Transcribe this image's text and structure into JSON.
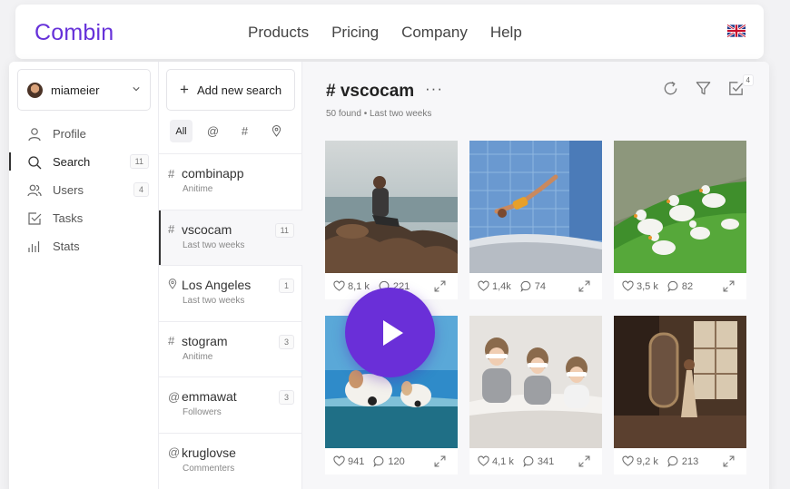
{
  "brand": {
    "logo": "Combin",
    "color": "#6631d9"
  },
  "nav": {
    "links": [
      "Products",
      "Pricing",
      "Company",
      "Help"
    ],
    "language_icon": "uk-flag-icon"
  },
  "sidebar": {
    "user": "miameier",
    "items": [
      {
        "label": "Profile",
        "icon": "user-icon"
      },
      {
        "label": "Search",
        "icon": "search-icon",
        "count": "11",
        "active": true
      },
      {
        "label": "Users",
        "icon": "users-icon",
        "count": "4"
      },
      {
        "label": "Tasks",
        "icon": "tasks-icon"
      },
      {
        "label": "Stats",
        "icon": "stats-icon"
      }
    ]
  },
  "searches": {
    "add_label": "Add new search",
    "filters": [
      "All",
      "@",
      "#",
      "location-pin-icon"
    ],
    "items": [
      {
        "type": "#",
        "name": "combinapp",
        "sub": "Anitime",
        "count": ""
      },
      {
        "type": "#",
        "name": "vscocam",
        "sub": "Last two weeks",
        "count": "11",
        "active": true
      },
      {
        "type": "pin",
        "name": "Los Angeles",
        "sub": "Last two weeks",
        "count": "1"
      },
      {
        "type": "#",
        "name": "stogram",
        "sub": "Anitime",
        "count": "3"
      },
      {
        "type": "@",
        "name": "emmawat",
        "sub": "Followers",
        "count": "3"
      },
      {
        "type": "@",
        "name": "kruglovse",
        "sub": "Commenters",
        "count": ""
      }
    ]
  },
  "main": {
    "title": "# vscocam",
    "found": "50 found",
    "period": "Last two weeks",
    "task_badge": "4",
    "posts": [
      {
        "likes": "8,1 k",
        "comments": "221"
      },
      {
        "likes": "1,4k",
        "comments": "74"
      },
      {
        "likes": "3,5 k",
        "comments": "82"
      },
      {
        "likes": "941",
        "comments": "120"
      },
      {
        "likes": "4,1 k",
        "comments": "341"
      },
      {
        "likes": "9,2 k",
        "comments": "213"
      }
    ]
  }
}
